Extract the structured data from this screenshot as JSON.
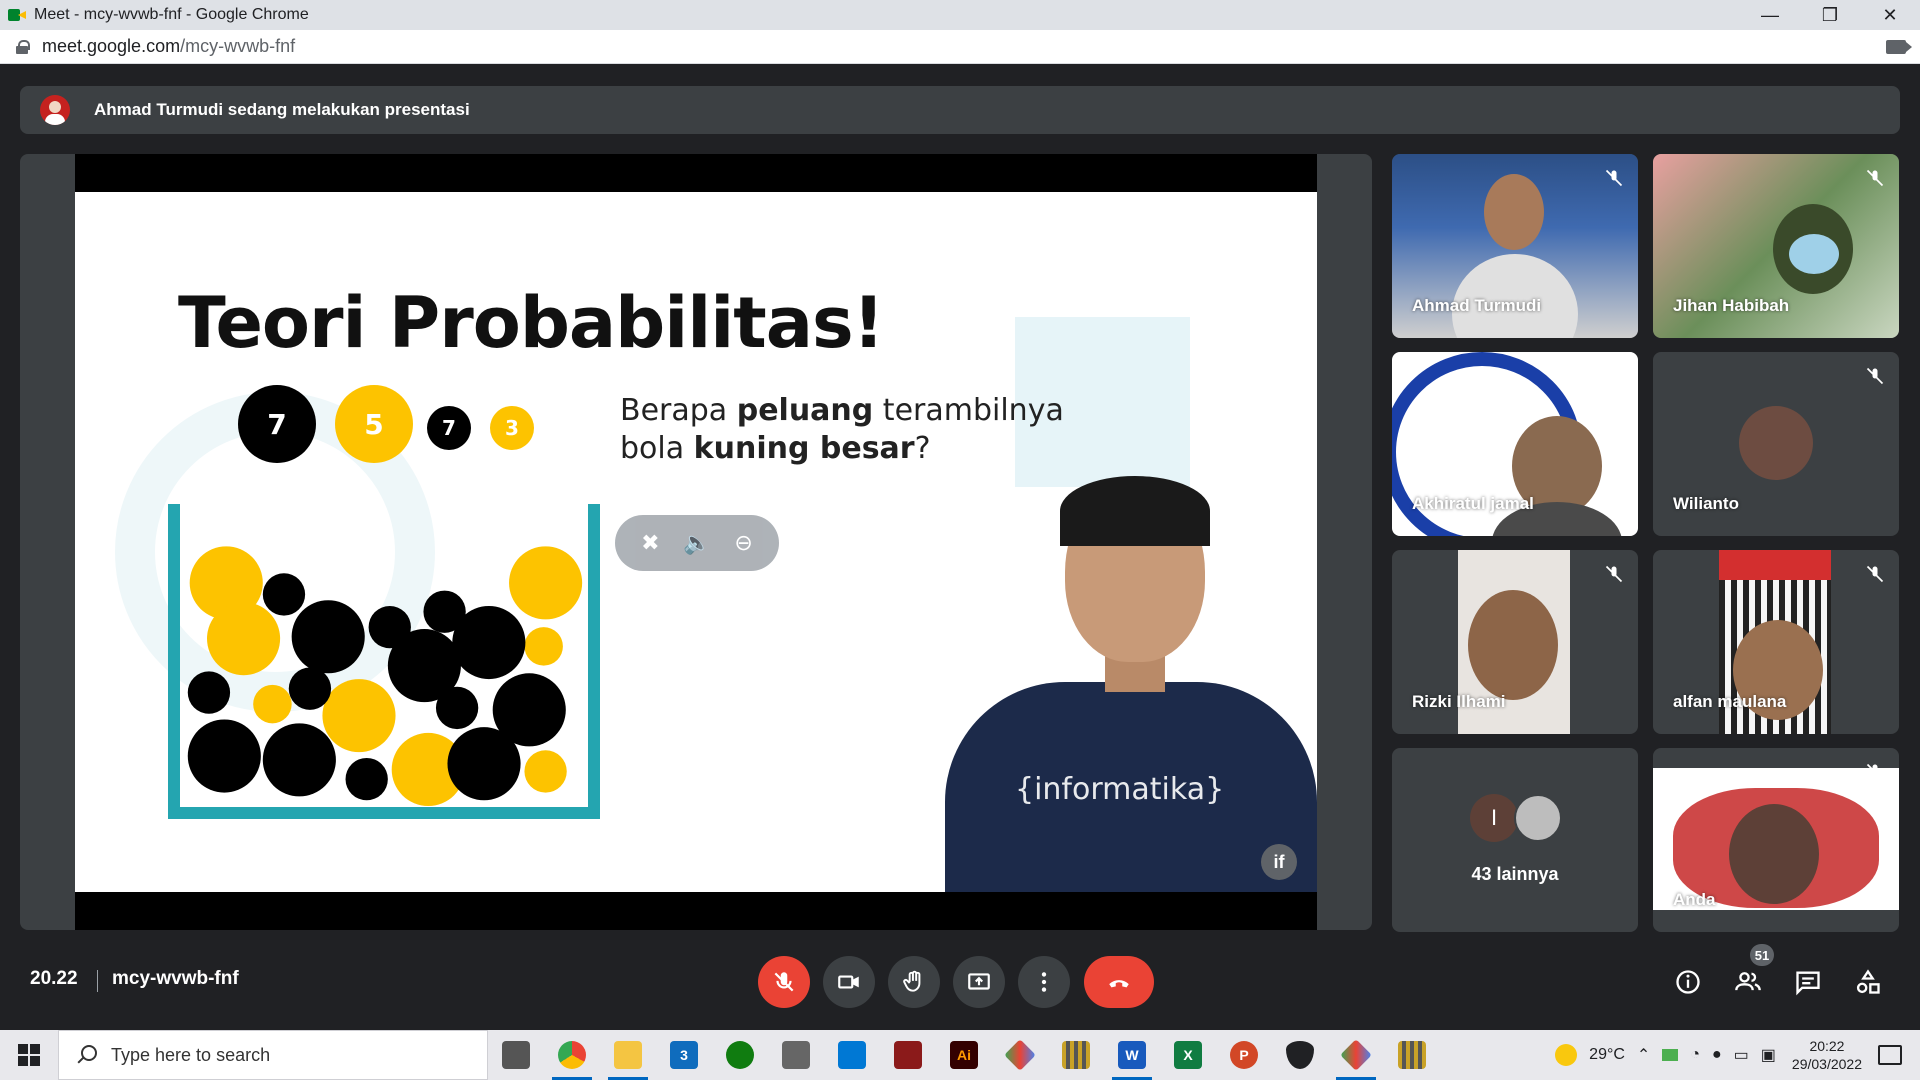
{
  "window": {
    "title": "Meet - mcy-wvwb-fnf - Google Chrome",
    "minimize": "—",
    "maximize": "❐",
    "close": "✕"
  },
  "address": {
    "domain": "meet.google.com",
    "path": "/mcy-wvwb-fnf"
  },
  "banner": {
    "text": "Ahmad Turmudi sedang melakukan presentasi"
  },
  "slide": {
    "title": "Teori Probabilitas!",
    "balls_labels": [
      "7",
      "5",
      "7",
      "3"
    ],
    "question_line1_pre": "Berapa ",
    "question_line1_bold": "peluang",
    "question_line1_post": " terambilnya",
    "question_line2_pre": "bola ",
    "question_line2_bold": "kuning besar",
    "question_line2_post": "?",
    "shirt_text": "{informatika}",
    "corner_logo": "if",
    "colors": {
      "yellow": "#fdc300",
      "black": "#000000",
      "jar": "#24a5b0"
    }
  },
  "participants": [
    {
      "name": "Ahmad Turmudi",
      "muted": true
    },
    {
      "name": "Jihan Habibah",
      "muted": true
    },
    {
      "name": "Akhiratul jamal",
      "muted": true
    },
    {
      "name": "Wilianto",
      "muted": true
    },
    {
      "name": "Rizki Ilhami",
      "muted": true
    },
    {
      "name": "alfan maulana",
      "muted": true
    },
    {
      "name": "Anda",
      "muted": true
    }
  ],
  "more": {
    "initial": "I",
    "label": "43 lainnya"
  },
  "bottom": {
    "time": "20.22",
    "code": "mcy-wvwb-fnf",
    "people_count": "51"
  },
  "taskbar": {
    "search_placeholder": "Type here to search",
    "weather": "29°C",
    "time": "20:22",
    "date": "29/03/2022",
    "mail_badge": "3"
  }
}
